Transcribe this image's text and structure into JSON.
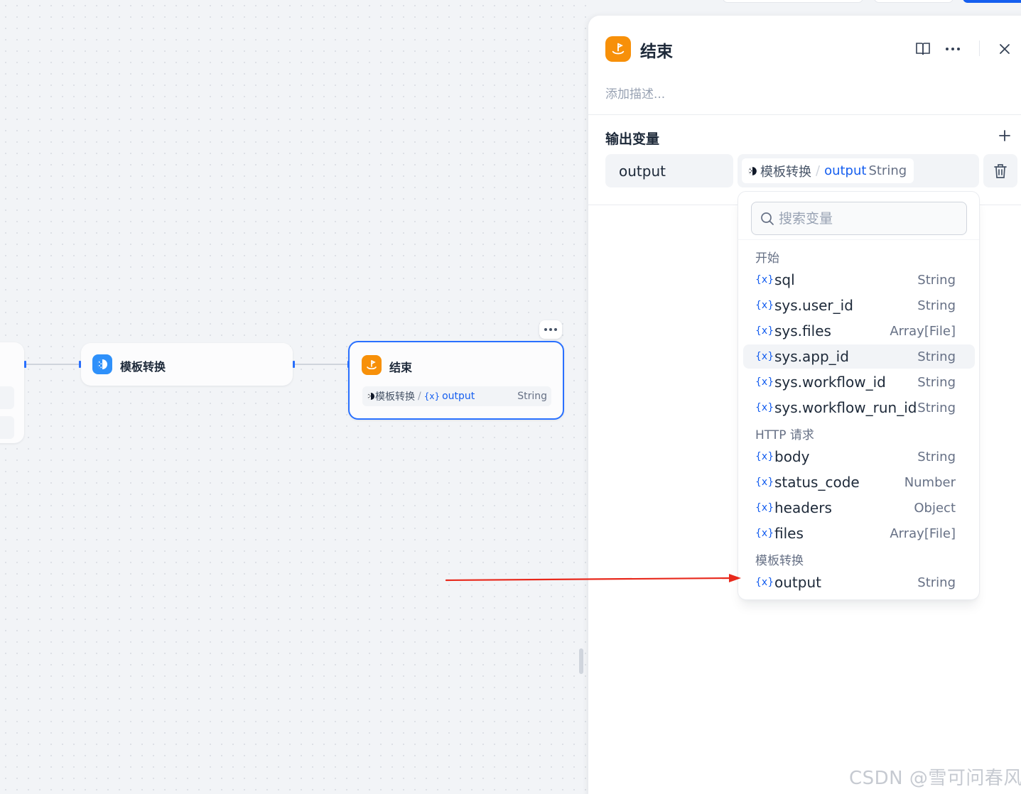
{
  "colors": {
    "accent": "#155eef",
    "end_node_icon": "#f79009",
    "template_node_icon": "#2e90fa",
    "arrow": "#e8291c"
  },
  "canvas": {
    "template_node": {
      "title": "模板转换",
      "icon": "template-transform-icon"
    },
    "end_node": {
      "title": "结束",
      "icon": "end-flag-icon",
      "variable": {
        "node_ref": "模板转换",
        "separator": "/",
        "token": "{x}",
        "name": "output",
        "type": "String"
      }
    }
  },
  "panel": {
    "title": "结束",
    "description_placeholder": "添加描述...",
    "output_section": {
      "title": "输出变量",
      "variable_name": "output",
      "selected": {
        "node_ref": "模板转换",
        "separator": "/",
        "name": "output",
        "type": "String"
      }
    }
  },
  "dropdown": {
    "search_placeholder": "搜索变量",
    "groups": [
      {
        "label": "开始",
        "items": [
          {
            "token": "{x}",
            "name": "sql",
            "type": "String"
          },
          {
            "token": "{x}",
            "name": "sys.user_id",
            "type": "String"
          },
          {
            "token": "{x}",
            "name": "sys.files",
            "type": "Array[File]"
          },
          {
            "token": "{x}",
            "name": "sys.app_id",
            "type": "String"
          },
          {
            "token": "{x}",
            "name": "sys.workflow_id",
            "type": "String"
          },
          {
            "token": "{x}",
            "name": "sys.workflow_run_id",
            "type": "String"
          }
        ]
      },
      {
        "label": "HTTP 请求",
        "items": [
          {
            "token": "{x}",
            "name": "body",
            "type": "String"
          },
          {
            "token": "{x}",
            "name": "status_code",
            "type": "Number"
          },
          {
            "token": "{x}",
            "name": "headers",
            "type": "Object"
          },
          {
            "token": "{x}",
            "name": "files",
            "type": "Array[File]"
          }
        ]
      },
      {
        "label": "模板转换",
        "items": [
          {
            "token": "{x}",
            "name": "output",
            "type": "String"
          }
        ]
      }
    ]
  },
  "watermark": "CSDN @雪可问春风"
}
